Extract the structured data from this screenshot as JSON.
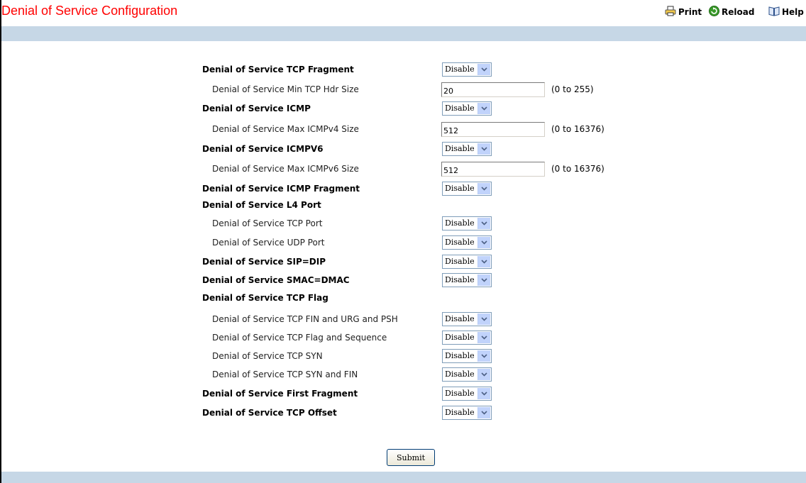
{
  "header": {
    "title": "Denial of Service Configuration",
    "toolbar": [
      {
        "label": "Print",
        "icon": "printer-icon"
      },
      {
        "label": "Reload",
        "icon": "reload-icon"
      },
      {
        "label": "Help",
        "icon": "help-book-icon"
      }
    ]
  },
  "colors": {
    "title": "#ff0000",
    "bar": "#c6d7e6"
  },
  "form": {
    "rows": [
      {
        "label": "Denial of Service TCP Fragment",
        "level": "main",
        "control": "select",
        "value": "Disable"
      },
      {
        "label": "Denial of Service Min TCP Hdr Size",
        "level": "sub",
        "control": "text",
        "value": "20",
        "range": "(0 to 255)"
      },
      {
        "label": "Denial of Service ICMP",
        "level": "main",
        "control": "select",
        "value": "Disable"
      },
      {
        "label": "Denial of Service Max ICMPv4 Size",
        "level": "sub",
        "control": "text",
        "value": "512",
        "range": "(0 to 16376)"
      },
      {
        "label": "Denial of Service ICMPV6",
        "level": "main",
        "control": "select",
        "value": "Disable"
      },
      {
        "label": "Denial of Service Max ICMPv6 Size",
        "level": "sub",
        "control": "text",
        "value": "512",
        "range": "(0 to 16376)"
      },
      {
        "label": "Denial of Service ICMP Fragment",
        "level": "main",
        "control": "select",
        "value": "Disable"
      },
      {
        "label": "Denial of Service L4 Port",
        "level": "main",
        "control": "none"
      },
      {
        "label": "Denial of Service TCP Port",
        "level": "sub",
        "control": "select",
        "value": "Disable"
      },
      {
        "label": "Denial of Service UDP Port",
        "level": "sub",
        "control": "select",
        "value": "Disable"
      },
      {
        "label": "Denial of Service SIP=DIP",
        "level": "main",
        "control": "select",
        "value": "Disable"
      },
      {
        "label": "Denial of Service SMAC=DMAC",
        "level": "main",
        "control": "select",
        "value": "Disable"
      },
      {
        "label": "Denial of Service TCP Flag",
        "level": "main",
        "control": "none"
      },
      {
        "label": "Denial of Service TCP FIN and URG and PSH",
        "level": "sub",
        "control": "select",
        "value": "Disable"
      },
      {
        "label": "Denial of Service TCP Flag and Sequence",
        "level": "sub",
        "control": "select",
        "value": "Disable"
      },
      {
        "label": "Denial of Service TCP SYN",
        "level": "sub",
        "control": "select",
        "value": "Disable"
      },
      {
        "label": "Denial of Service TCP SYN and FIN",
        "level": "sub",
        "control": "select",
        "value": "Disable"
      },
      {
        "label": "Denial of Service First Fragment",
        "level": "main",
        "control": "select",
        "value": "Disable"
      },
      {
        "label": "Denial of Service TCP Offset",
        "level": "main",
        "control": "select",
        "value": "Disable"
      }
    ],
    "submit_label": "Submit"
  }
}
